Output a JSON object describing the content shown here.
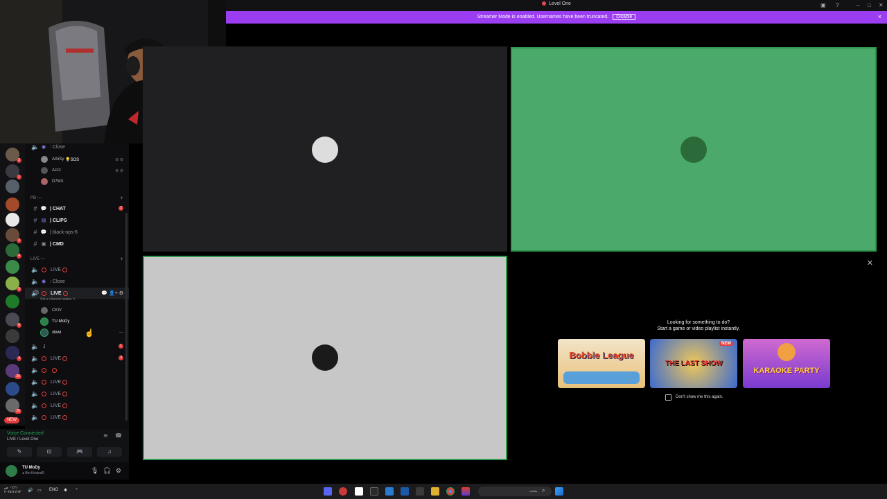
{
  "window": {
    "title": "Level One"
  },
  "banner": {
    "message": "Streamer Mode is enabled. Usernames have been truncated.",
    "disable_label": "Disable",
    "close": "×"
  },
  "rail": {
    "badges": [
      "2",
      "1",
      "3",
      "4",
      "9",
      "6",
      "4",
      "30",
      "26"
    ],
    "new_label": "NEW"
  },
  "channels": {
    "row_close_top": {
      "label": ": Close"
    },
    "members_top": [
      {
        "name": "Alörßy",
        "tag": "💡SOS"
      },
      {
        "name": "Azzz"
      },
      {
        "name": "D7MX"
      }
    ],
    "category_pb": "PB —",
    "text_channels": [
      {
        "label": "| CHAT",
        "badge": "2"
      },
      {
        "label": "| CLIPS"
      },
      {
        "label": "| black-ops-6"
      },
      {
        "label": "| CMD"
      }
    ],
    "category_live": "LIVE —",
    "live1": {
      "label": "LIVE"
    },
    "close2": {
      "label": ": Close"
    },
    "active": {
      "label": "LIVE",
      "status": "Set a channel status ✎"
    },
    "active_members": [
      {
        "name": "CKIV"
      },
      {
        "name": "TU MoDy"
      },
      {
        "name": "xlxwi"
      }
    ],
    "j_row": {
      "label": "J",
      "badge": "1"
    },
    "live_rows": [
      {
        "label": "LIVE",
        "badge": "3"
      },
      {
        "label": ""
      },
      {
        "label": "LIVE"
      },
      {
        "label": "LIVE"
      },
      {
        "label": "LIVE"
      },
      {
        "label": "LIVE"
      }
    ]
  },
  "voice": {
    "title": "Voice Connected",
    "subtitle": "LIVE  / Level One"
  },
  "user": {
    "name": "TU MoDy",
    "status": "● Bin Khaled0"
  },
  "activity": {
    "heading1": "Looking for something to do?",
    "heading2": "Start a game or video playlist instantly.",
    "cards": [
      {
        "title": "Bobble League",
        "badge": ""
      },
      {
        "title": "THE LAST SHOW",
        "badge": "NEW"
      },
      {
        "title": "KARAOKE PARTY",
        "badge": ""
      }
    ],
    "dont_show": "Don't show me this again."
  },
  "taskbar": {
    "clock": "٠٦:٢١ ص\n٢٠٢٤/١١/١٣",
    "lang": "ENG",
    "search_placeholder": "بحث"
  },
  "colors": {
    "accent": "#9b3df0",
    "green": "#4aa96b",
    "red": "#e23d3d"
  }
}
